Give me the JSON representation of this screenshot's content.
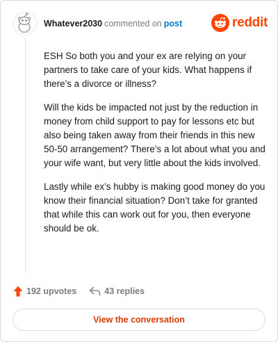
{
  "header": {
    "username": "Whatever2030",
    "commented_text": "commented on",
    "post_link": "post",
    "brand_name": "reddit",
    "avatar_icon": "snoo-avatar-icon",
    "brand_icon": "reddit-logo-icon"
  },
  "comment": {
    "paragraphs": [
      "ESH So both you and your ex are relying on your partners to take care of your kids. What happens if there’s a divorce or illness?",
      "Will the kids be impacted not just by the reduction in money from child support to pay for lessons etc but also being taken away from their friends in this new 50-50 arrangement? There’s a lot about what you and your wife want, but very little about the kids involved.",
      "Lastly while ex’s hubby is making good money do you know their financial situation? Don’t take for granted that while this can work out for you, then everyone should be ok."
    ]
  },
  "stats": {
    "upvotes": "192 upvotes",
    "replies": "43 replies",
    "upvote_icon": "upvote-arrow-icon",
    "reply_icon": "reply-arrow-icon"
  },
  "cta": {
    "label": "View the conversation"
  },
  "colors": {
    "brand": "#ff4500",
    "link": "#0079d3",
    "cta_text": "#d93a00",
    "muted": "#7c7c7c"
  }
}
